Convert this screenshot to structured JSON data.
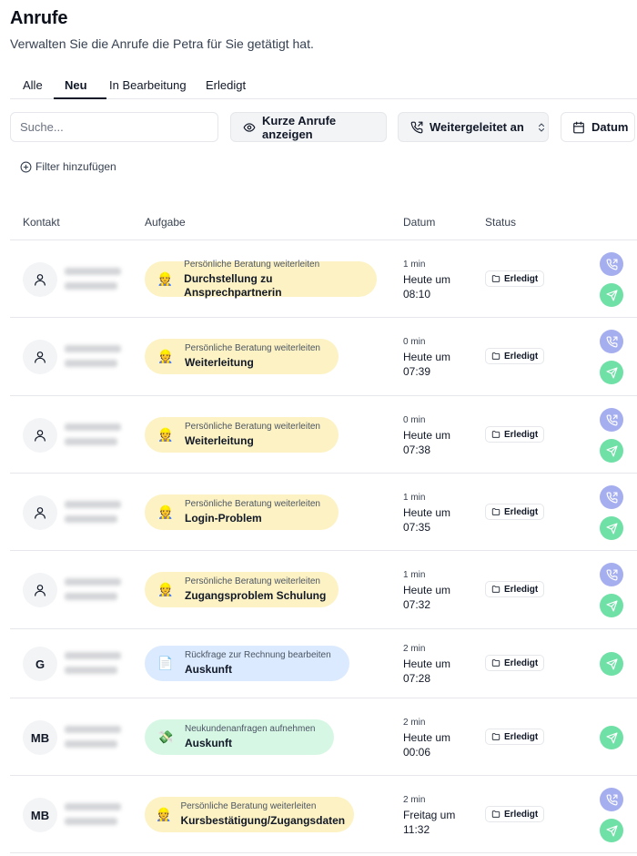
{
  "page": {
    "title": "Anrufe",
    "subtitle": "Verwalten Sie die Anrufe die Petra für Sie getätigt hat."
  },
  "tabs": [
    {
      "label": "Alle",
      "active": false
    },
    {
      "label": "Neu",
      "active": true
    },
    {
      "label": "In Bearbeitung",
      "active": false
    },
    {
      "label": "Erledigt",
      "active": false
    }
  ],
  "toolbar": {
    "search_placeholder": "Suche...",
    "short_calls_label": "Kurze Anrufe anzeigen",
    "forwarded_label": "Weitergeleitet an",
    "date_label": "Datum",
    "add_filter_label": "Filter hinzufügen"
  },
  "table": {
    "headers": {
      "contact": "Kontakt",
      "task": "Aufgabe",
      "date": "Datum",
      "status": "Status"
    },
    "rows": [
      {
        "avatar": "",
        "avatar_icon": "user-icon",
        "emoji": "👷",
        "color": "yellow",
        "category": "Persönliche Beratung weiterleiten",
        "task": "Durchstellung zu Ansprechpartnerin",
        "duration": "1 min",
        "date_line1": "Heute um",
        "date_line2": "08:10",
        "status": "Erledigt",
        "has_call_action": true
      },
      {
        "avatar": "",
        "avatar_icon": "user-icon",
        "emoji": "👷",
        "color": "yellow",
        "category": "Persönliche Beratung weiterleiten",
        "task": "Weiterleitung",
        "duration": "0 min",
        "date_line1": "Heute um",
        "date_line2": "07:39",
        "status": "Erledigt",
        "has_call_action": true
      },
      {
        "avatar": "",
        "avatar_icon": "user-icon",
        "emoji": "👷",
        "color": "yellow",
        "category": "Persönliche Beratung weiterleiten",
        "task": "Weiterleitung",
        "duration": "0 min",
        "date_line1": "Heute um",
        "date_line2": "07:38",
        "status": "Erledigt",
        "has_call_action": true
      },
      {
        "avatar": "",
        "avatar_icon": "user-icon",
        "emoji": "👷",
        "color": "yellow",
        "category": "Persönliche Beratung weiterleiten",
        "task": "Login-Problem",
        "duration": "1 min",
        "date_line1": "Heute um",
        "date_line2": "07:35",
        "status": "Erledigt",
        "has_call_action": true
      },
      {
        "avatar": "",
        "avatar_icon": "user-icon",
        "emoji": "👷",
        "color": "yellow",
        "category": "Persönliche Beratung weiterleiten",
        "task": "Zugangsproblem Schulung",
        "duration": "1 min",
        "date_line1": "Heute um",
        "date_line2": "07:32",
        "status": "Erledigt",
        "has_call_action": true
      },
      {
        "avatar": "G",
        "avatar_icon": "",
        "emoji": "📄",
        "color": "blue",
        "category": "Rückfrage zur Rechnung bearbeiten",
        "task": "Auskunft",
        "duration": "2 min",
        "date_line1": "Heute um",
        "date_line2": "07:28",
        "status": "Erledigt",
        "has_call_action": false
      },
      {
        "avatar": "MB",
        "avatar_icon": "",
        "emoji": "💸",
        "color": "green",
        "category": "Neukundenanfragen aufnehmen",
        "task": "Auskunft",
        "duration": "2 min",
        "date_line1": "Heute um",
        "date_line2": "00:06",
        "status": "Erledigt",
        "has_call_action": false
      },
      {
        "avatar": "MB",
        "avatar_icon": "",
        "emoji": "👷",
        "color": "yellow",
        "category": "Persönliche Beratung weiterleiten",
        "task": "Kursbestätigung/Zugangsdaten",
        "duration": "2 min",
        "date_line1": "Freitag um",
        "date_line2": "11:32",
        "status": "Erledigt",
        "has_call_action": true
      }
    ]
  },
  "colors": {
    "call_action": "#a5aeee",
    "send_action": "#6fe0a6",
    "pill_yellow": "#fdf2c3",
    "pill_blue": "#dbeafe",
    "pill_green": "#d7f7e5"
  }
}
